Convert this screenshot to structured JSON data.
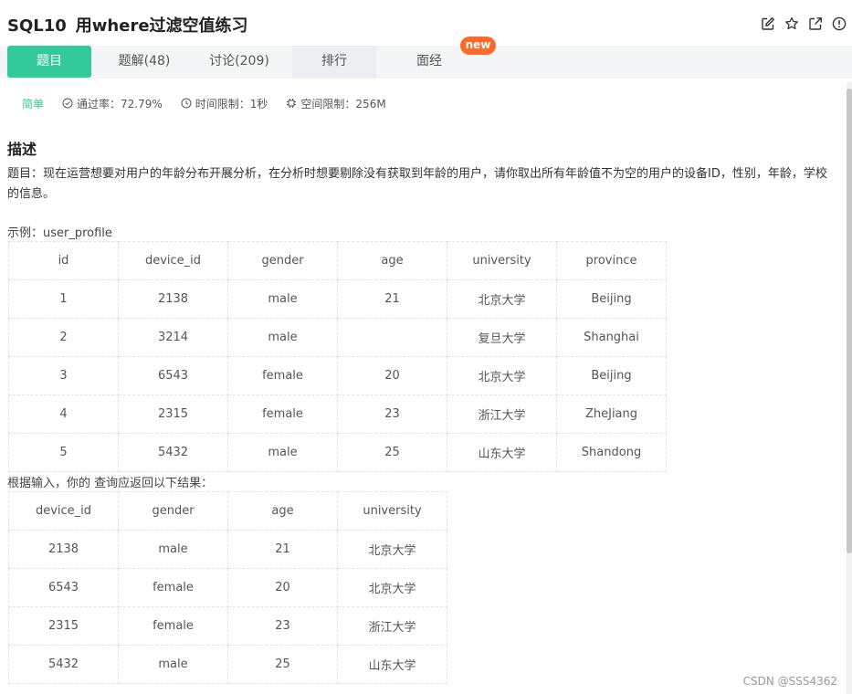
{
  "header": {
    "code": "SQL10",
    "title": "用where过滤空值练习",
    "icons": [
      "edit-icon",
      "star-icon",
      "share-icon",
      "info-icon"
    ]
  },
  "tabs": [
    {
      "label": "题目",
      "active": true
    },
    {
      "label": "题解(48)"
    },
    {
      "label": "讨论(209)"
    },
    {
      "label": "排行"
    },
    {
      "label": "面经",
      "badge": "new"
    }
  ],
  "meta": {
    "difficulty": "简单",
    "pass_rate": "通过率：72.79%",
    "time_limit": "时间限制：1秒",
    "space_limit": "空间限制：256M"
  },
  "description": {
    "heading": "描述",
    "text": "题目：现在运营想要对用户的年龄分布开展分析，在分析时想要剔除没有获取到年龄的用户，请你取出所有年龄值不为空的用户的设备ID，性别，年龄，学校的信息。",
    "example_label": "示例：user_profile",
    "result_label": "根据输入，你的 查询应返回以下结果："
  },
  "example_table": {
    "columns": [
      "id",
      "device_id",
      "gender",
      "age",
      "university",
      "province"
    ],
    "rows": [
      [
        "1",
        "2138",
        "male",
        "21",
        "北京大学",
        "Beijing"
      ],
      [
        "2",
        "3214",
        "male",
        "",
        "复旦大学",
        "Shanghai"
      ],
      [
        "3",
        "6543",
        "female",
        "20",
        "北京大学",
        "Beijing"
      ],
      [
        "4",
        "2315",
        "female",
        "23",
        "浙江大学",
        "ZheJiang"
      ],
      [
        "5",
        "5432",
        "male",
        "25",
        "山东大学",
        "Shandong"
      ]
    ]
  },
  "result_table": {
    "columns": [
      "device_id",
      "gender",
      "age",
      "university"
    ],
    "rows": [
      [
        "2138",
        "male",
        "21",
        "北京大学"
      ],
      [
        "6543",
        "female",
        "20",
        "北京大学"
      ],
      [
        "2315",
        "female",
        "23",
        "浙江大学"
      ],
      [
        "5432",
        "male",
        "25",
        "山东大学"
      ]
    ]
  },
  "footer": {
    "watermark": "CSDN @SSS4362"
  },
  "colors": {
    "accent": "#32ca99",
    "badge": "#ff6a2b",
    "tab_bar": "#f4f5f7"
  }
}
